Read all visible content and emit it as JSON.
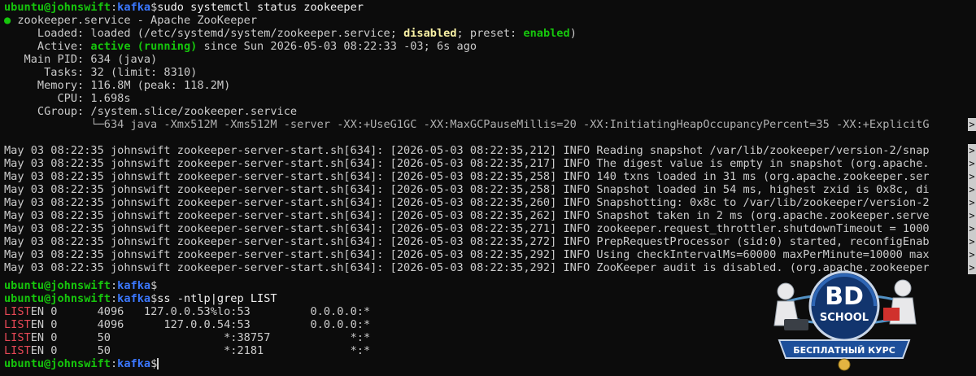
{
  "prompt": {
    "user": "ubuntu@johnswift",
    "sep": ":",
    "path": "kafka",
    "symbol": "$"
  },
  "commands": {
    "status": "sudo systemctl status zookeeper",
    "ss": "ss -ntlp|grep LIST",
    "empty": ""
  },
  "status": {
    "bullet": "●",
    "title": " zookeeper.service - Apache ZooKeeper",
    "loaded_label": "     Loaded: ",
    "loaded_pre": "loaded (/etc/systemd/system/zookeeper.service; ",
    "loaded_disabled": "disabled",
    "loaded_mid": "; preset: ",
    "loaded_enabled": "enabled",
    "loaded_post": ")",
    "active_label": "     Active: ",
    "active_state": "active (running)",
    "active_rest": " since Sun 2026-05-03 08:22:33 -03; 6s ago",
    "mainpid": "   Main PID: 634 (java)",
    "tasks": "      Tasks: 32 (limit: 8310)",
    "memory": "     Memory: 116.8M (peak: 118.2M)",
    "cpu": "        CPU: 1.698s",
    "cgroup": "     CGroup: /system.slice/zookeeper.service",
    "cgroup_child": "             └─634 java -Xmx512M -Xms512M -server -XX:+UseG1GC -XX:MaxGCPauseMillis=20 -XX:InitiatingHeapOccupancyPercent=35 -XX:+ExplicitG"
  },
  "logs": [
    "May 03 08:22:35 johnswift zookeeper-server-start.sh[634]: [2026-05-03 08:22:35,212] INFO Reading snapshot /var/lib/zookeeper/version-2/snap",
    "May 03 08:22:35 johnswift zookeeper-server-start.sh[634]: [2026-05-03 08:22:35,217] INFO The digest value is empty in snapshot (org.apache.",
    "May 03 08:22:35 johnswift zookeeper-server-start.sh[634]: [2026-05-03 08:22:35,258] INFO 140 txns loaded in 31 ms (org.apache.zookeeper.ser",
    "May 03 08:22:35 johnswift zookeeper-server-start.sh[634]: [2026-05-03 08:22:35,258] INFO Snapshot loaded in 54 ms, highest zxid is 0x8c, di",
    "May 03 08:22:35 johnswift zookeeper-server-start.sh[634]: [2026-05-03 08:22:35,260] INFO Snapshotting: 0x8c to /var/lib/zookeeper/version-2",
    "May 03 08:22:35 johnswift zookeeper-server-start.sh[634]: [2026-05-03 08:22:35,262] INFO Snapshot taken in 2 ms (org.apache.zookeeper.serve",
    "May 03 08:22:35 johnswift zookeeper-server-start.sh[634]: [2026-05-03 08:22:35,271] INFO zookeeper.request_throttler.shutdownTimeout = 1000",
    "May 03 08:22:35 johnswift zookeeper-server-start.sh[634]: [2026-05-03 08:22:35,272] INFO PrepRequestProcessor (sid:0) started, reconfigEnab",
    "May 03 08:22:35 johnswift zookeeper-server-start.sh[634]: [2026-05-03 08:22:35,292] INFO Using checkIntervalMs=60000 maxPerMinute=10000 max",
    "May 03 08:22:35 johnswift zookeeper-server-start.sh[634]: [2026-05-03 08:22:35,292] INFO ZooKeeper audit is disabled. (org.apache.zookeeper"
  ],
  "truncation_marker": ">",
  "listen_rows": [
    {
      "match": "LIST",
      "rest": "EN 0      4096   127.0.0.53%lo:53         0.0.0.0:*"
    },
    {
      "match": "LIST",
      "rest": "EN 0      4096      127.0.0.54:53         0.0.0.0:*"
    },
    {
      "match": "LIST",
      "rest": "EN 0      50                 *:38757            *:*"
    },
    {
      "match": "LIST",
      "rest": "EN 0      50                 *:2181             *:*"
    }
  ],
  "logo": {
    "top": "BD",
    "middle": "SCHOOL",
    "ribbon": "БЕСПЛАТНЫЙ КУРС"
  },
  "colors": {
    "background": "#0c0c0c",
    "text": "#cccccc",
    "user": "#16c60c",
    "path": "#3b78ff",
    "match": "#e74856",
    "warn": "#f9f1a5"
  }
}
